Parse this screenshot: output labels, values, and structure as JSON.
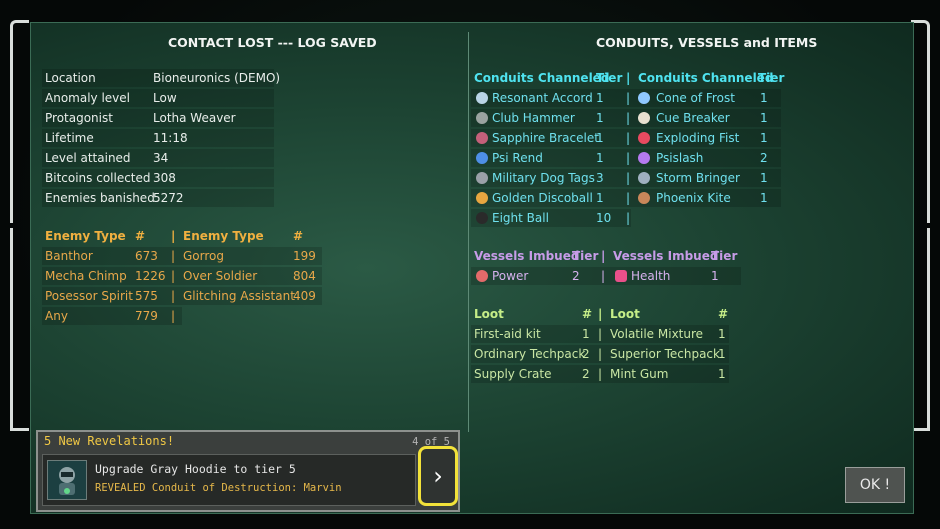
{
  "left": {
    "title": "CONTACT LOST --- LOG SAVED",
    "stats": [
      {
        "label": "Location",
        "value": "Bioneuronics (DEMO)"
      },
      {
        "label": "Anomaly level",
        "value": "Low"
      },
      {
        "label": "Protagonist",
        "value": "Lotha Weaver"
      },
      {
        "label": "Lifetime",
        "value": "11:18"
      },
      {
        "label": "Level attained",
        "value": "34"
      },
      {
        "label": "Bitcoins collected",
        "value": "308"
      },
      {
        "label": "Enemies banished",
        "value": "5272"
      }
    ],
    "enemy_header": {
      "type": "Enemy Type",
      "count": "#",
      "sep": "|",
      "type2": "Enemy Type",
      "count2": "#"
    },
    "enemies": [
      {
        "t1": "Banthor",
        "c1": "673",
        "t2": "Gorrog",
        "c2": "199"
      },
      {
        "t1": "Mecha Chimp",
        "c1": "1226",
        "t2": "Over Soldier",
        "c2": "804"
      },
      {
        "t1": "Posessor Spirit",
        "c1": "575",
        "t2": "Glitching Assistant",
        "c2": "409"
      },
      {
        "t1": "Any",
        "c1": "779",
        "t2": "",
        "c2": ""
      }
    ]
  },
  "right": {
    "title": "CONDUITS, VESSELS and ITEMS",
    "conduit_header": {
      "name": "Conduits Channeled",
      "tier": "Tier",
      "sep": "|"
    },
    "conduits": [
      {
        "n1": "Resonant Accord",
        "t1": "1",
        "n2": "Cone of Frost",
        "t2": "1"
      },
      {
        "n1": "Club Hammer",
        "t1": "1",
        "n2": "Cue Breaker",
        "t2": "1"
      },
      {
        "n1": "Sapphire Bracelet",
        "t1": "1",
        "n2": "Exploding Fist",
        "t2": "1"
      },
      {
        "n1": "Psi Rend",
        "t1": "1",
        "n2": "Psislash",
        "t2": "2"
      },
      {
        "n1": "Military Dog Tags",
        "t1": "3",
        "n2": "Storm Bringer",
        "t2": "1"
      },
      {
        "n1": "Golden Discoball",
        "t1": "1",
        "n2": "Phoenix Kite",
        "t2": "1"
      },
      {
        "n1": "Eight Ball",
        "t1": "10",
        "n2": "",
        "t2": ""
      }
    ],
    "vessel_header": {
      "name": "Vessels Imbued",
      "tier": "Tier",
      "sep": "|"
    },
    "vessels": [
      {
        "n1": "Power",
        "t1": "2",
        "n2": "Health",
        "t2": "1"
      }
    ],
    "loot_header": {
      "name": "Loot",
      "count": "#",
      "sep": "|"
    },
    "loot": [
      {
        "n1": "First-aid kit",
        "c1": "1",
        "n2": "Volatile Mixture",
        "c2": "1"
      },
      {
        "n1": "Ordinary Techpack",
        "c1": "2",
        "n2": "Superior Techpack",
        "c2": "1"
      },
      {
        "n1": "Supply Crate",
        "c1": "2",
        "n2": "Mint Gum",
        "c2": "1"
      }
    ]
  },
  "revelations": {
    "header": "5 New Revelations!",
    "count": "4 of 5",
    "line1": "Upgrade Gray Hoodie to tier 5",
    "line2": "REVEALED Conduit of Destruction: Marvin"
  },
  "buttons": {
    "next": "›",
    "ok": "OK !"
  },
  "icon_colors": {
    "resonant": "#b9d4e6",
    "hammer": "#9aa3a0",
    "sapphire": "#c4607a",
    "psirend": "#4e8fe6",
    "dogtags": "#9aa0a8",
    "discoball": "#e8a640",
    "eightball": "#2a2a2a",
    "frost": "#8fc8ff",
    "cue": "#e8e0d0",
    "fist": "#e84a60",
    "psislash": "#b57af0",
    "storm": "#9fb0c0",
    "kite": "#c9875a",
    "power": "#e36a6a",
    "health": "#e8508a"
  }
}
